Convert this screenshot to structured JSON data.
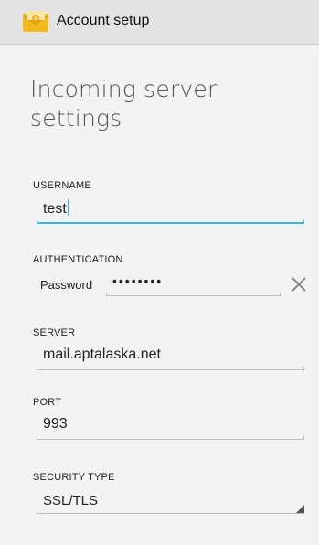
{
  "action_bar": {
    "title": "Account setup",
    "icon": "email-app-icon"
  },
  "page": {
    "heading": "Incoming server settings"
  },
  "username": {
    "label": "USERNAME",
    "value": "test"
  },
  "authentication": {
    "label": "AUTHENTICATION",
    "method_label": "Password",
    "password_masked": "••••••••",
    "clear_icon": "close-icon"
  },
  "server": {
    "label": "SERVER",
    "value": "mail.aptalaska.net"
  },
  "port": {
    "label": "PORT",
    "value": "993"
  },
  "security_type": {
    "label": "SECURITY TYPE",
    "value": "SSL/TLS"
  },
  "colors": {
    "accent": "#33b5e5",
    "action_bar_bg": "#e3e3e3",
    "background": "#f3f3f3"
  }
}
